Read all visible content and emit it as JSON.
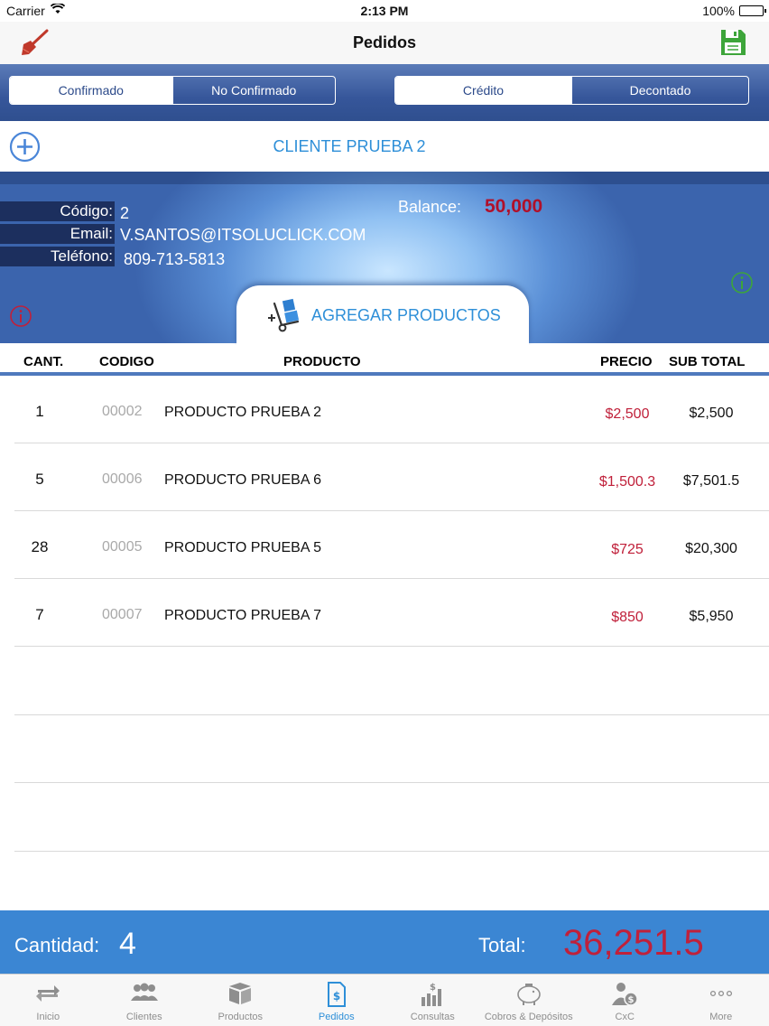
{
  "status_bar": {
    "carrier": "Carrier",
    "time": "2:13 PM",
    "battery": "100%"
  },
  "nav": {
    "title": "Pedidos",
    "left_icon": "broom-icon",
    "right_icon": "save-icon"
  },
  "segments": {
    "confirm": {
      "on": "Confirmado",
      "off": "No Confirmado"
    },
    "payment": {
      "on": "Crédito",
      "off": "Decontado"
    }
  },
  "client": {
    "name": "CLIENTE PRUEBA 2"
  },
  "info": {
    "code_label": "Código:",
    "code": "2",
    "email_label": "Email:",
    "email": "V.SANTOS@ITSOLUCLICK.COM",
    "phone_label": "Teléfono:",
    "phone": "809-713-5813",
    "balance_label": "Balance:",
    "balance": "50,000",
    "add_products": "AGREGAR PRODUCTOS"
  },
  "table": {
    "headers": {
      "qty": "CANT.",
      "code": "CODIGO",
      "product": "PRODUCTO",
      "price": "PRECIO",
      "subtotal": "SUB TOTAL"
    },
    "rows": [
      {
        "qty": "1",
        "code": "00002",
        "product": "PRODUCTO PRUEBA 2",
        "price": "$2,500",
        "subtotal": "$2,500"
      },
      {
        "qty": "5",
        "code": "00006",
        "product": "PRODUCTO PRUEBA 6",
        "price": "$1,500.3",
        "subtotal": "$7,501.5"
      },
      {
        "qty": "28",
        "code": "00005",
        "product": "PRODUCTO PRUEBA 5",
        "price": "$725",
        "subtotal": "$20,300"
      },
      {
        "qty": "7",
        "code": "00007",
        "product": "PRODUCTO PRUEBA 7",
        "price": "$850",
        "subtotal": "$5,950"
      }
    ]
  },
  "totals": {
    "qty_label": "Cantidad:",
    "qty": "4",
    "total_label": "Total:",
    "total": "36,251.5"
  },
  "tabs": [
    {
      "label": "Inicio",
      "icon": "swap-arrows-icon"
    },
    {
      "label": "Clientes",
      "icon": "people-icon"
    },
    {
      "label": "Productos",
      "icon": "boxes-icon"
    },
    {
      "label": "Pedidos",
      "icon": "invoice-icon",
      "active": true
    },
    {
      "label": "Consultas",
      "icon": "chart-icon"
    },
    {
      "label": "Cobros & Depósitos",
      "icon": "piggy-bank-icon"
    },
    {
      "label": "CxC",
      "icon": "person-money-icon"
    },
    {
      "label": "More",
      "icon": "more-icon"
    }
  ],
  "colors": {
    "accent": "#2e8fd8",
    "header_blue": "#36569a",
    "price_red": "#c0203a",
    "save_green": "#3da53a"
  }
}
